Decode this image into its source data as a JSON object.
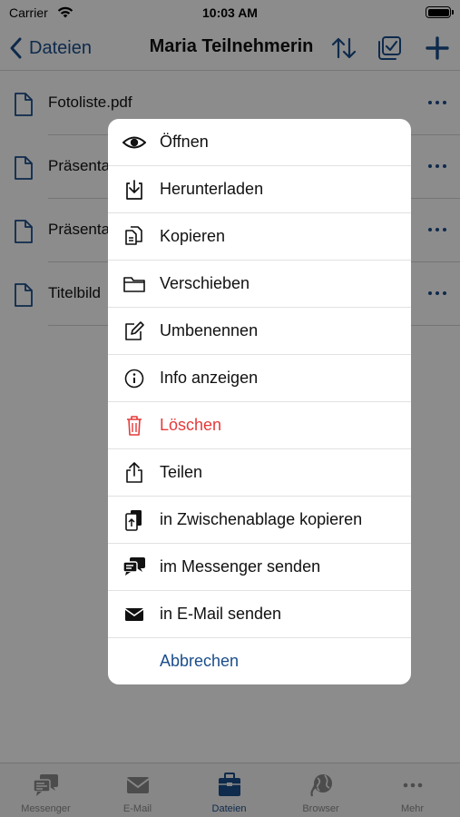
{
  "status_bar": {
    "carrier": "Carrier",
    "time": "10:03 AM"
  },
  "navbar": {
    "back_label": "Dateien",
    "title": "Maria Teilnehmerin"
  },
  "files": [
    {
      "name": "Fotoliste.pdf"
    },
    {
      "name": "Präsenta"
    },
    {
      "name": "Präsenta"
    },
    {
      "name": "Titelbild"
    }
  ],
  "action_sheet": {
    "items": [
      {
        "label": "Öffnen",
        "icon": "eye-icon"
      },
      {
        "label": "Herunterladen",
        "icon": "download-icon"
      },
      {
        "label": "Kopieren",
        "icon": "copy-icon"
      },
      {
        "label": "Verschieben",
        "icon": "folder-icon"
      },
      {
        "label": "Umbenennen",
        "icon": "edit-icon"
      },
      {
        "label": "Info anzeigen",
        "icon": "info-icon"
      },
      {
        "label": "Löschen",
        "icon": "trash-icon",
        "destructive": true
      },
      {
        "label": "Teilen",
        "icon": "share-icon"
      },
      {
        "label": "in Zwischenablage kopieren",
        "icon": "clipboard-icon"
      },
      {
        "label": "im Messenger senden",
        "icon": "messenger-icon"
      },
      {
        "label": "in E-Mail senden",
        "icon": "mail-icon"
      }
    ],
    "cancel_label": "Abbrechen"
  },
  "tabbar": {
    "tabs": [
      {
        "label": "Messenger",
        "icon": "messenger-icon"
      },
      {
        "label": "E-Mail",
        "icon": "mail-icon"
      },
      {
        "label": "Dateien",
        "icon": "briefcase-icon",
        "active": true
      },
      {
        "label": "Browser",
        "icon": "globe-icon"
      },
      {
        "label": "Mehr",
        "icon": "more-icon"
      }
    ]
  },
  "colors": {
    "accent": "#1b4d8a",
    "destructive": "#e53a3a",
    "overlay": "rgba(0,0,0,0.45)"
  }
}
